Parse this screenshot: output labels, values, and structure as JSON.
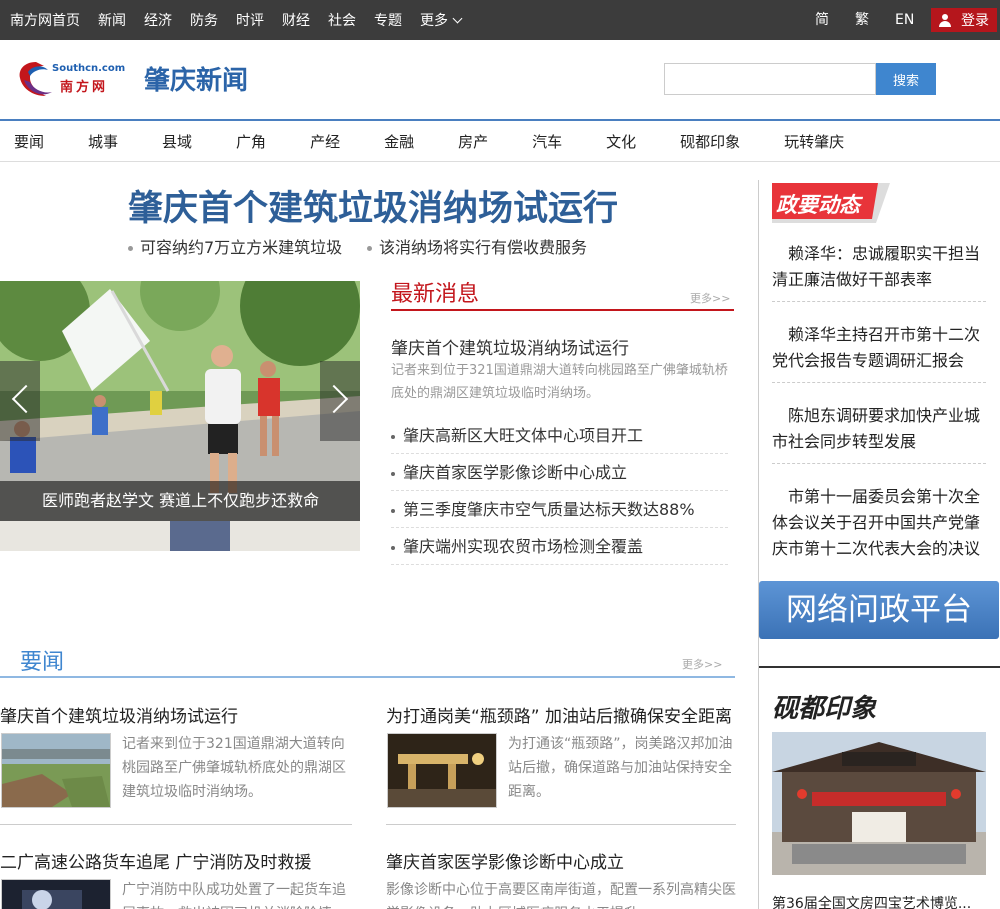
{
  "topbar": {
    "nav": [
      "南方网首页",
      "新闻",
      "经济",
      "防务",
      "时评",
      "财经",
      "社会",
      "专题"
    ],
    "more_label": "更多",
    "lang": {
      "simplified": "简",
      "traditional": "繁",
      "english": "EN"
    },
    "login_label": "登录"
  },
  "header": {
    "logo_text_en": "Southcn.com",
    "logo_text_cn": "南方网",
    "title": "肇庆新闻",
    "search": {
      "placeholder": "",
      "button_label": "搜索"
    }
  },
  "channel_nav": [
    "要闻",
    "城事",
    "县域",
    "广角",
    "产经",
    "金融",
    "房产",
    "汽车",
    "文化",
    "砚都印象",
    "玩转肇庆"
  ],
  "headline": {
    "title": "肇庆首个建筑垃圾消纳场试运行",
    "subs": [
      "可容纳约7万立方米建筑垃圾",
      "该消纳场将实行有偿收费服务"
    ]
  },
  "slider": {
    "caption": "医师跑者赵学文 赛道上不仅跑步还救命",
    "colors": {
      "overlay": "#000000"
    }
  },
  "latest": {
    "title": "最新消息",
    "more": "更多>>",
    "lead_title": "肇庆首个建筑垃圾消纳场试运行",
    "lead_desc": "记者来到位于321国道鼎湖大道转向桃园路至广佛肇城轨桥底处的鼎湖区建筑垃圾临时消纳场。",
    "items": [
      "肇庆高新区大旺文体中心项目开工",
      "肇庆首家医学影像诊断中心成立",
      "第三季度肇庆市空气质量达标天数达88%",
      "肇庆端州实现农贸市场检测全覆盖"
    ]
  },
  "sidebar": {
    "gov_title": "政要动态",
    "gov_items": [
      "赖泽华：忠诚履职实干担当 清正廉洁做好干部表率",
      "赖泽华主持召开市第十二次党代会报告专题调研汇报会",
      "陈旭东调研要求加快产业城市社会同步转型发展",
      "市第十一届委员会第十次全体会议关于召开中国共产党肇庆市第十二次代表大会的决议"
    ],
    "platform_label": "网络问政平台",
    "impression_title": "砚都印象",
    "impression_caption": "第36届全国文房四宝艺术博览..."
  },
  "yaowen": {
    "title": "要闻",
    "more": "更多>>",
    "articles": [
      {
        "title": "肇庆首个建筑垃圾消纳场试运行",
        "desc": "记者来到位于321国道鼎湖大道转向桃园路至广佛肇城轨桥底处的鼎湖区建筑垃圾临时消纳场。"
      },
      {
        "title": "为打通岗美“瓶颈路” 加油站后撤确保安全距离",
        "desc": "为打通该“瓶颈路”，岗美路汉邦加油站后撤，确保道路与加油站保持安全距离。"
      },
      {
        "title": "二广高速公路货车追尾 广宁消防及时救援",
        "desc": "广宁消防中队成功处置了一起货车追尾事故，救出被困司机并消除险情。"
      },
      {
        "title": "肇庆首家医学影像诊断中心成立",
        "desc": "影像诊断中心位于高要区南岸街道，配置一系列高精尖医学影像设备，助力区域医疗服务水平提升。"
      }
    ]
  },
  "colors": {
    "brand_blue": "#2e5f98",
    "accent_red": "#c3161c",
    "topbar": "#3c3c3c",
    "link_blue": "#3f86cf"
  }
}
